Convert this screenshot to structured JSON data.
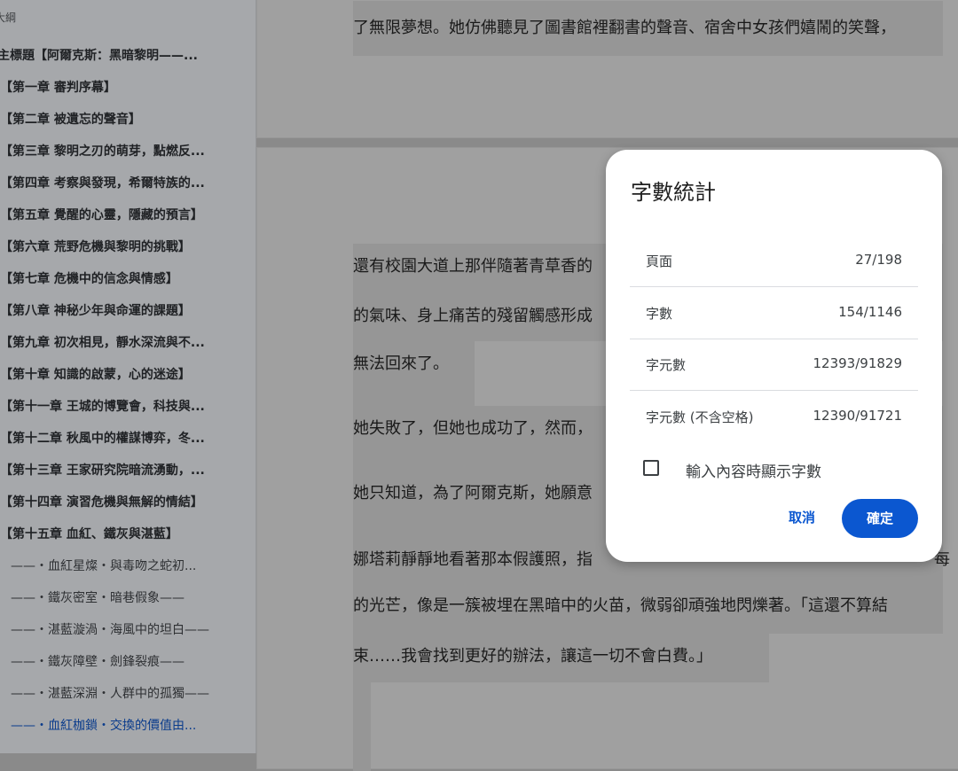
{
  "sidebar": {
    "label": "大綱",
    "items": [
      {
        "text": "主標題【阿爾克斯：黑暗黎明——...",
        "level": 1
      },
      {
        "text": "【第一章 審判序幕】",
        "level": 2
      },
      {
        "text": "【第二章 被遺忘的聲音】",
        "level": 2
      },
      {
        "text": "【第三章 黎明之刃的萌芽，點燃反...",
        "level": 2
      },
      {
        "text": "【第四章 考察與發現，希爾特族的...",
        "level": 2
      },
      {
        "text": "【第五章 覺醒的心靈，隱藏的預言】",
        "level": 2
      },
      {
        "text": "【第六章 荒野危機與黎明的挑戰】",
        "level": 2
      },
      {
        "text": "【第七章 危機中的信念與情感】",
        "level": 2
      },
      {
        "text": "【第八章 神秘少年與命運的課題】",
        "level": 2
      },
      {
        "text": "【第九章 初次相見，靜水深流與不...",
        "level": 2
      },
      {
        "text": "【第十章 知識的啟蒙，心的迷途】",
        "level": 2
      },
      {
        "text": "【第十一章 王城的博覽會，科技與...",
        "level": 2
      },
      {
        "text": "【第十二章 秋風中的權謀博弈，冬...",
        "level": 2
      },
      {
        "text": "【第十三章 王家研究院暗流湧動，...",
        "level": 2
      },
      {
        "text": "【第十四章 演習危機與無解的情結】",
        "level": 2
      },
      {
        "text": "【第十五章 血紅、鐵灰與湛藍】",
        "level": 2
      },
      {
        "text": "——・血紅星燦・與毒吻之蛇初...",
        "level": 3
      },
      {
        "text": "——・鐵灰密室・暗巷假象——",
        "level": 3
      },
      {
        "text": "——・湛藍漩渦・海風中的坦白——",
        "level": 3
      },
      {
        "text": "——・鐵灰障壁・劍鋒裂痕——",
        "level": 3
      },
      {
        "text": "——・湛藍深淵・人群中的孤獨——",
        "level": 3
      },
      {
        "text": "——・血紅枷鎖・交換的價值由...",
        "level": 3,
        "active": true
      }
    ]
  },
  "document": {
    "page1_line": "了無限夢想。她仿佛聽見了圖書館裡翻書的聲音、宿舍中女孩們嬉鬧的笑聲，",
    "lines": [
      "還有校園大道上那伴隨著青草香的",
      "的氣味、身上痛苦的殘留觸感形成",
      "無法回來了。",
      "她失敗了，但她也成功了，然而，",
      "她只知道，為了阿爾克斯，她願意",
      "娜塔莉靜靜地看著那本假護照，指",
      "的光芒，像是一簇被埋在黑暗中的火苗，微弱卻頑強地閃爍著。「這還不算結",
      "束……我會找到更好的辦法，讓這一切不會白費。」"
    ],
    "line_tail": "每"
  },
  "dialog": {
    "title": "字數統計",
    "rows": [
      {
        "label": "頁面",
        "value": "27/198"
      },
      {
        "label": "字數",
        "value": "154/1146"
      },
      {
        "label": "字元數",
        "value": "12393/91829"
      },
      {
        "label": "字元數 (不含空格)",
        "value": "12390/91721"
      }
    ],
    "checkbox_label": "輸入內容時顯示字數",
    "checkbox_checked": false,
    "cancel_label": "取消",
    "ok_label": "確定"
  },
  "colors": {
    "accent": "#0b57d0",
    "active_outline": "#0b3c8c"
  }
}
